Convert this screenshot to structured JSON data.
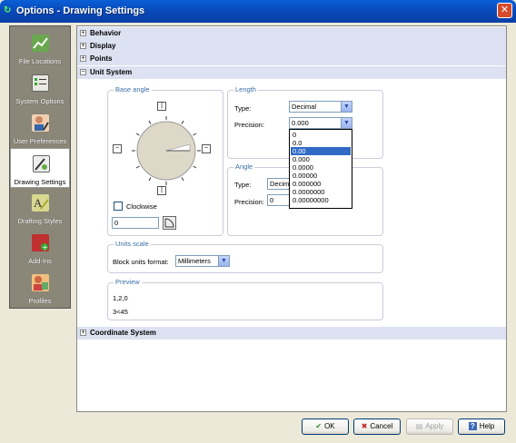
{
  "window": {
    "title": "Options - Drawing Settings"
  },
  "sidebar": {
    "items": [
      {
        "label": "File Locations",
        "icon": "folder-chart-icon",
        "color": "#5a8a3a"
      },
      {
        "label": "System Options",
        "icon": "checklist-icon",
        "color": "#4a7a2a"
      },
      {
        "label": "User Preferences",
        "icon": "user-pencil-icon",
        "color": "#7a5a8a"
      },
      {
        "label": "Drawing Settings",
        "icon": "drawing-settings-icon",
        "color": "#3a6a3a"
      },
      {
        "label": "Drafting Styles",
        "icon": "drafting-styles-icon",
        "color": "#7a8a2a"
      },
      {
        "label": "Add-Ins",
        "icon": "addins-icon",
        "color": "#c03030"
      },
      {
        "label": "Profiles",
        "icon": "profiles-icon",
        "color": "#c08030"
      }
    ],
    "selected_index": 3
  },
  "tree": {
    "behavior": "Behavior",
    "display": "Display",
    "points": "Points",
    "unit_system": "Unit System",
    "coordinate_system": "Coordinate System"
  },
  "base_angle": {
    "title": "Base angle",
    "clockwise_label": "Clockwise",
    "value": "0"
  },
  "length": {
    "title": "Length",
    "type_label": "Type:",
    "type_value": "Decimal",
    "precision_label": "Precision:",
    "precision_value": "0.000"
  },
  "precision_dropdown": {
    "options": [
      "0",
      "0.0",
      "0.00",
      "0.000",
      "0.0000",
      "0.00000",
      "0.000000",
      "0.0000000",
      "0.00000000"
    ],
    "highlighted_index": 2
  },
  "angle": {
    "title": "Angle",
    "type_label": "Type:",
    "type_value": "Decima",
    "precision_label": "Precision:",
    "precision_value": "0"
  },
  "units_scale": {
    "title": "Units scale",
    "block_units_label": "Block units format:",
    "block_units_value": "Millimeters"
  },
  "preview": {
    "title": "Preview",
    "line1": "1,2,0",
    "line2": "3<45"
  },
  "buttons": {
    "ok": "OK",
    "cancel": "Cancel",
    "apply": "Apply",
    "help": "Help"
  },
  "colors": {
    "titlebar": "#0a48b8",
    "selected_option": "#316ac5",
    "group_title": "#3a6ea5"
  }
}
